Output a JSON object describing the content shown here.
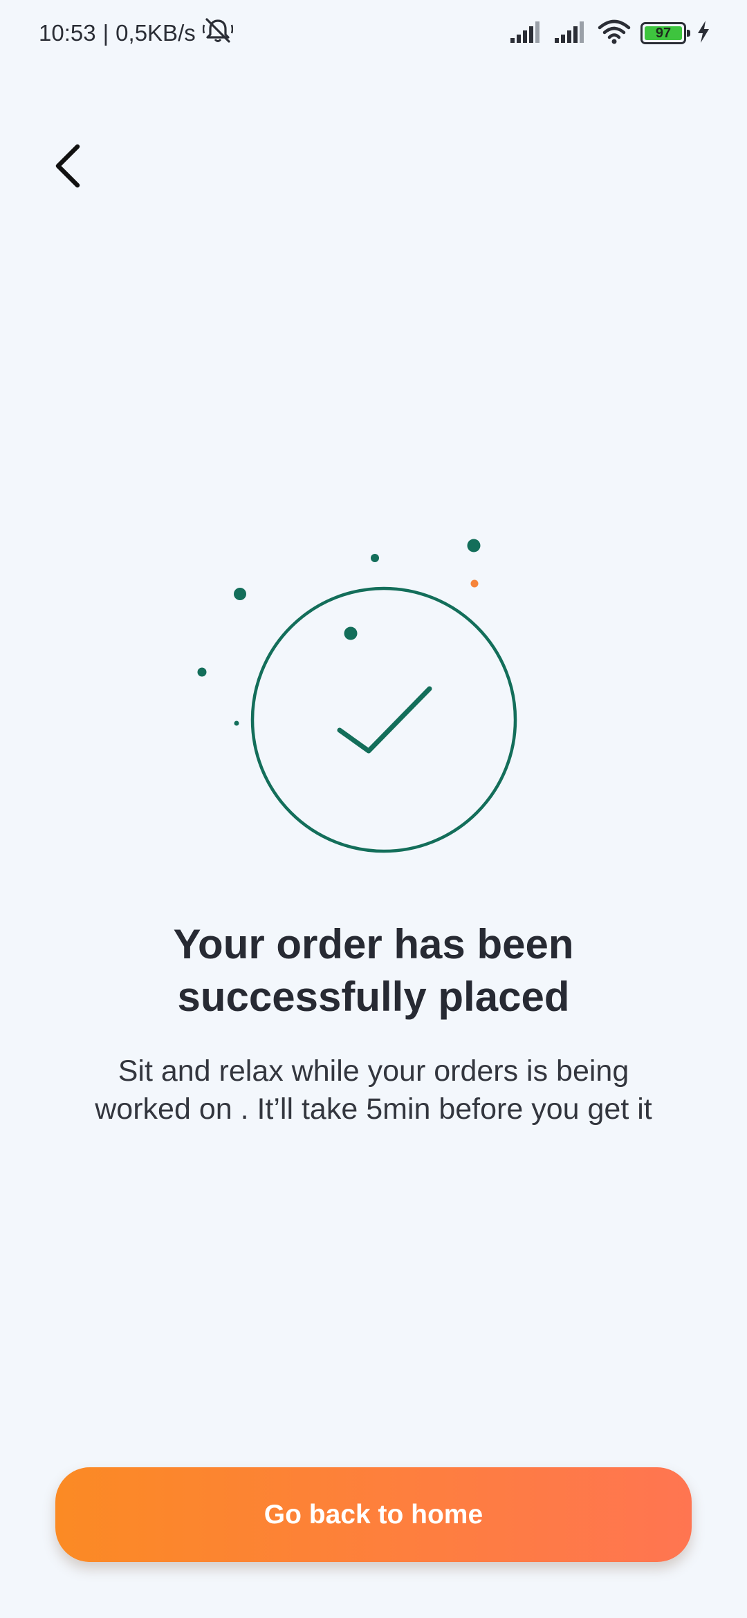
{
  "status_bar": {
    "time": "10:53",
    "separator": "|",
    "network_speed": "0,5KB/s",
    "battery_level": "97",
    "icons": [
      "silent-bell-icon",
      "signal-icon",
      "signal-icon",
      "wifi-icon",
      "battery-icon",
      "charging-icon"
    ]
  },
  "header": {
    "back_icon": "chevron-left-icon"
  },
  "illustration": {
    "icon": "checkmark-circle-icon",
    "accent_color": "#136e5a",
    "highlight_color": "#f6843a"
  },
  "confirmation": {
    "title_line1": "Your order has been",
    "title_line2": "successfully placed",
    "subtitle_line1": "Sit and relax while your orders is being",
    "subtitle_line2": "worked on . It’ll take 5min before you get it"
  },
  "actions": {
    "home_button_label": "Go back to home"
  },
  "colors": {
    "background": "#f3f7fc",
    "button_gradient_start": "#fb8a24",
    "button_gradient_end": "#ff7551",
    "text_primary": "#272a33"
  }
}
